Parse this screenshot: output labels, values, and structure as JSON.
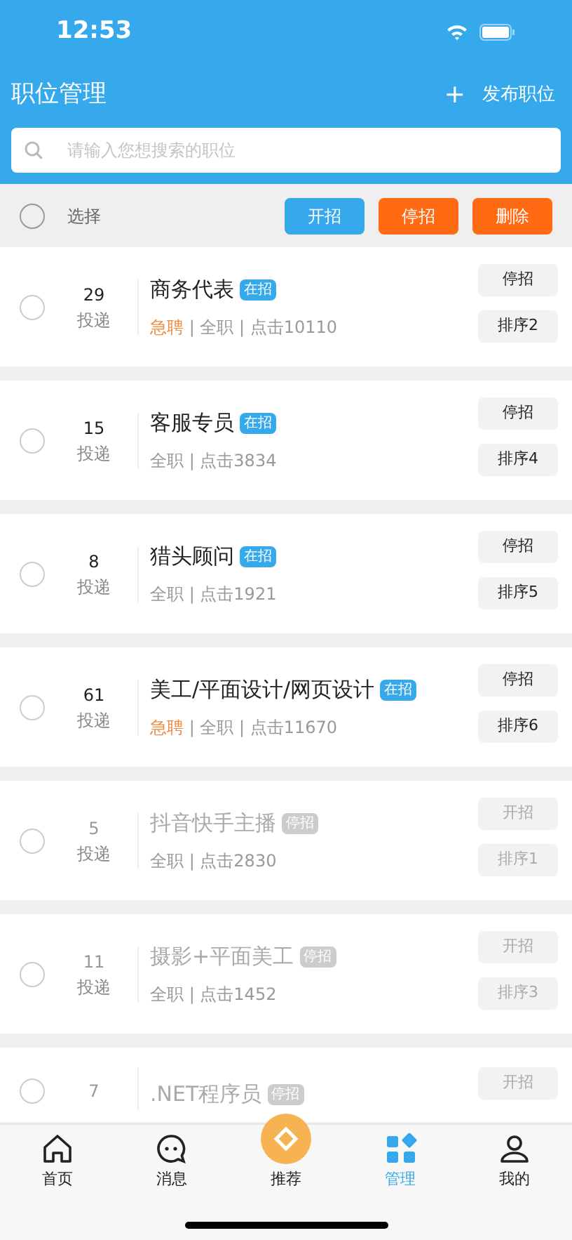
{
  "status_bar": {
    "time": "12:53"
  },
  "header": {
    "title": "职位管理",
    "action_icon": "+",
    "action": "发布职位"
  },
  "search": {
    "placeholder": "请输入您想搜索的职位"
  },
  "toolbar": {
    "select_all": {
      "label": "选择",
      "checked": false
    },
    "buttons": [
      {
        "label": "开招",
        "kind": "blue"
      },
      {
        "label": "停招",
        "kind": "orange"
      },
      {
        "label": "删除",
        "kind": "orange"
      }
    ]
  },
  "jobs": [
    {
      "checked": false,
      "count": "29",
      "count_label": "投递",
      "title": "商务代表",
      "badge": "在招",
      "open": true,
      "urgent": "急聘",
      "meta": "| 全职 | 点击10110",
      "action": "停招",
      "sort": "排序2"
    },
    {
      "checked": false,
      "count": "15",
      "count_label": "投递",
      "title": "客服专员",
      "badge": "在招",
      "open": true,
      "meta": "全职 | 点击3834",
      "action": "停招",
      "sort": "排序4"
    },
    {
      "checked": false,
      "count": "8",
      "count_label": "投递",
      "title": "猎头顾问",
      "badge": "在招",
      "open": true,
      "meta": "全职 | 点击1921",
      "action": "停招",
      "sort": "排序5"
    },
    {
      "checked": false,
      "count": "61",
      "count_label": "投递",
      "title": "美工/平面设计/网页设计",
      "badge": "在招",
      "open": true,
      "urgent": "急聘",
      "meta": "| 全职 | 点击11670",
      "action": "停招",
      "sort": "排序6"
    },
    {
      "checked": false,
      "count": "5",
      "count_label": "投递",
      "title": "抖音快手主播",
      "badge": "停招",
      "open": false,
      "meta": "全职 | 点击2830",
      "action": "开招",
      "sort": "排序1"
    },
    {
      "checked": false,
      "count": "11",
      "count_label": "投递",
      "title": "摄影+平面美工",
      "badge": "停招",
      "open": false,
      "meta": "全职 | 点击1452",
      "action": "开招",
      "sort": "排序3"
    },
    {
      "checked": false,
      "count": "7",
      "title": ".NET程序员",
      "badge": "停招",
      "open": false,
      "action": "开招"
    }
  ],
  "tab_bar": [
    {
      "label": "首页",
      "selected": false
    },
    {
      "label": "消息",
      "selected": false
    },
    {
      "label": "推荐",
      "selected": false
    },
    {
      "label": "管理",
      "selected": true
    },
    {
      "label": "我的",
      "selected": false
    }
  ]
}
